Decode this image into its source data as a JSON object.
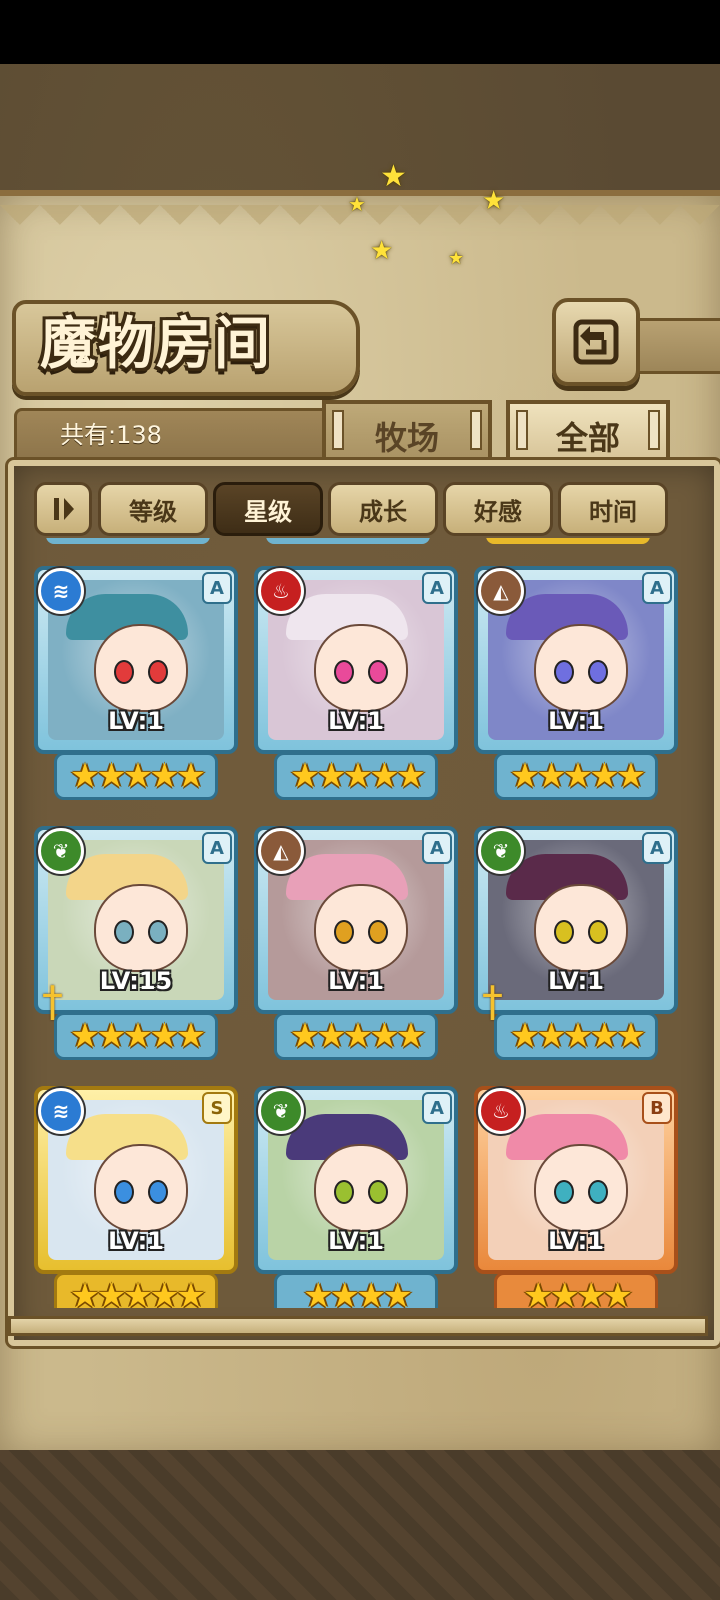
{
  "header": {
    "title": "魔物房间",
    "back_icon": "back-arrow-icon"
  },
  "summary": {
    "count_label": "共有:138"
  },
  "tabs": [
    {
      "label": "牧场",
      "active": false
    },
    {
      "label": "全部",
      "active": true
    }
  ],
  "sort": {
    "toggle_icon": "sort-order-icon",
    "buttons": [
      {
        "label": "等级",
        "active": false
      },
      {
        "label": "星级",
        "active": true
      },
      {
        "label": "成长",
        "active": false
      },
      {
        "label": "好感",
        "active": false
      },
      {
        "label": "时间",
        "active": false
      }
    ]
  },
  "monsters": [
    {
      "element": "water",
      "rank": "A",
      "level": "LV:1",
      "stars": 5,
      "weapon": false
    },
    {
      "element": "fire",
      "rank": "A",
      "level": "LV:1",
      "stars": 5,
      "weapon": false
    },
    {
      "element": "earth",
      "rank": "A",
      "level": "LV:1",
      "stars": 5,
      "weapon": false
    },
    {
      "element": "wood",
      "rank": "A",
      "level": "LV:15",
      "stars": 5,
      "weapon": true
    },
    {
      "element": "earth",
      "rank": "A",
      "level": "LV:1",
      "stars": 5,
      "weapon": false
    },
    {
      "element": "wood",
      "rank": "A",
      "level": "LV:1",
      "stars": 5,
      "weapon": true
    },
    {
      "element": "water",
      "rank": "S",
      "level": "LV:1",
      "stars": 5,
      "weapon": false
    },
    {
      "element": "wood",
      "rank": "A",
      "level": "LV:1",
      "stars": 4,
      "weapon": false
    },
    {
      "element": "fire",
      "rank": "B",
      "level": "LV:1",
      "stars": 4,
      "weapon": false
    }
  ],
  "colors": {
    "star": "#ffc81e",
    "rank_a_frame": "#2f6f8c",
    "rank_s_frame": "#a37a10",
    "rank_b_frame": "#a8501a"
  }
}
